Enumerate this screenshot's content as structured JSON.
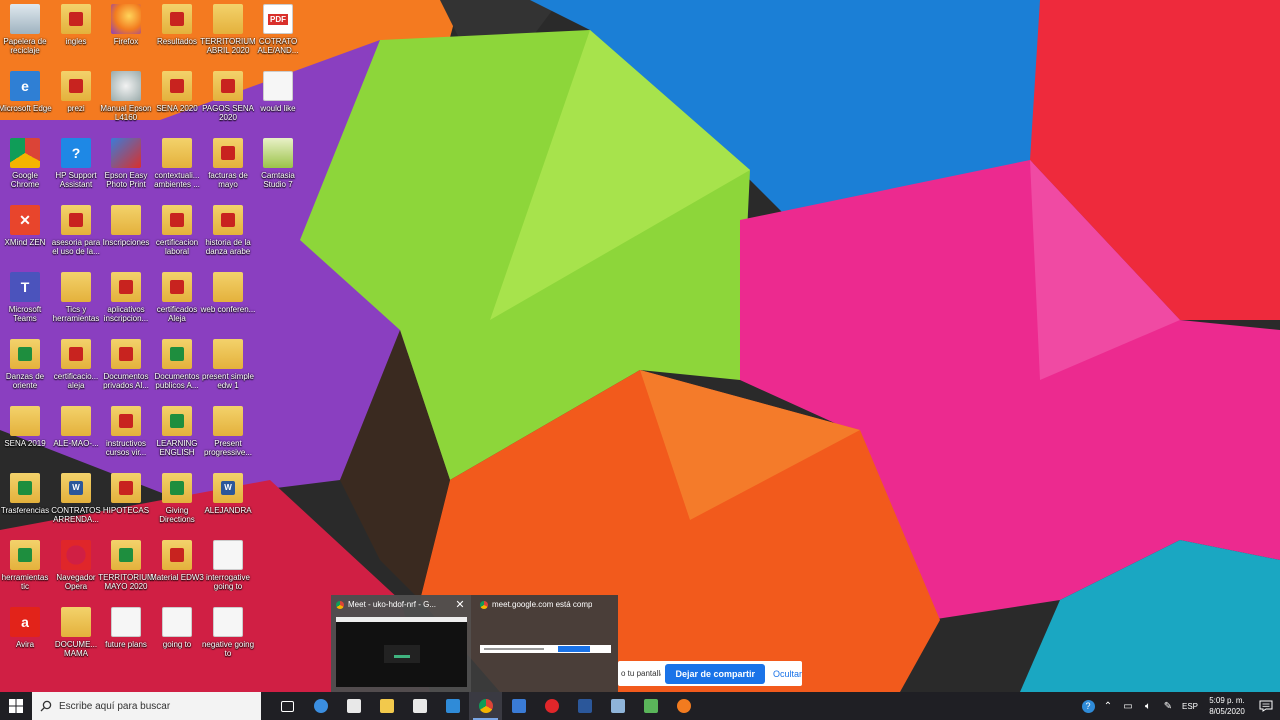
{
  "desktop_icons": [
    {
      "label": "Papelera de reciclaje",
      "type": "bin"
    },
    {
      "label": "Microsoft Edge",
      "type": "edge"
    },
    {
      "label": "Google Chrome",
      "type": "chrome"
    },
    {
      "label": "XMind ZEN",
      "type": "xmind"
    },
    {
      "label": "Microsoft Teams",
      "type": "teams"
    },
    {
      "label": "Danzas de oriente",
      "type": "folder-sheet"
    },
    {
      "label": "SENA 2019",
      "type": "folder"
    },
    {
      "label": "Trasferencias",
      "type": "folder-sheet"
    },
    {
      "label": "herramientas tic",
      "type": "folder-sheet"
    },
    {
      "label": "Avira",
      "type": "avira"
    },
    {
      "label": "ingles",
      "type": "folder-acro"
    },
    {
      "label": "prezi",
      "type": "folder-acro"
    },
    {
      "label": "HP Support Assistant",
      "type": "hp"
    },
    {
      "label": "asesoria para el uso de la...",
      "type": "folder-acro"
    },
    {
      "label": "Tics y herramientas",
      "type": "folder"
    },
    {
      "label": "certificacio... aleja",
      "type": "folder-acro"
    },
    {
      "label": "ALE-MAO-...",
      "type": "folder"
    },
    {
      "label": "CONTRATOS ARRENDA...",
      "type": "folder-word"
    },
    {
      "label": "Navegador Opera",
      "type": "opera"
    },
    {
      "label": "DOCUME... MAMA",
      "type": "folder"
    },
    {
      "label": "Firefox",
      "type": "firefox"
    },
    {
      "label": "Manual Epson L4160",
      "type": "epson"
    },
    {
      "label": "Epson Easy Photo Print",
      "type": "epsonphoto"
    },
    {
      "label": "Inscripciones",
      "type": "folder"
    },
    {
      "label": "aplicativos inscripcion...",
      "type": "folder-acro"
    },
    {
      "label": "Documentos privados Al...",
      "type": "folder-acro"
    },
    {
      "label": "instructivos cursos vir...",
      "type": "folder-acro"
    },
    {
      "label": "HIPOTECAS",
      "type": "folder-acro"
    },
    {
      "label": "TERRITORIUM MAYO 2020",
      "type": "folder-sheet"
    },
    {
      "label": "future plans",
      "type": "doc"
    },
    {
      "label": "Resultados",
      "type": "folder-acro"
    },
    {
      "label": "SENA 2020",
      "type": "folder-acro"
    },
    {
      "label": "contextuali... ambientes ...",
      "type": "folder"
    },
    {
      "label": "certificacion laboral",
      "type": "folder-acro"
    },
    {
      "label": "certificados Aleja",
      "type": "folder-acro"
    },
    {
      "label": "Documentos publicos A...",
      "type": "folder-sheet"
    },
    {
      "label": "LEARNING ENGLISH",
      "type": "folder-sheet"
    },
    {
      "label": "Giving Directions",
      "type": "folder-sheet"
    },
    {
      "label": "Material EDW3",
      "type": "folder-acro"
    },
    {
      "label": "going to",
      "type": "doc"
    },
    {
      "label": "TERRITORIUM ABRIL 2020",
      "type": "folder"
    },
    {
      "label": "PAGOS SENA 2020",
      "type": "folder-acro"
    },
    {
      "label": "facturas de mayo",
      "type": "folder-acro"
    },
    {
      "label": "historia de la danza arabe",
      "type": "folder-acro"
    },
    {
      "label": "web conferen...",
      "type": "folder"
    },
    {
      "label": "present simple edw 1",
      "type": "folder"
    },
    {
      "label": "Present progressive...",
      "type": "folder"
    },
    {
      "label": "ALEJANDRA",
      "type": "folder-word"
    },
    {
      "label": "interrogative going to",
      "type": "doc"
    },
    {
      "label": "negative going to",
      "type": "doc"
    },
    {
      "label": "COTRATO ALE/AND...",
      "type": "pdf"
    },
    {
      "label": "would like",
      "type": "doc"
    },
    {
      "label": "Camtasia Studio 7",
      "type": "camtasia"
    }
  ],
  "pdf_badge": "PDF",
  "thumbnails": [
    {
      "title": "Meet - uko-hdof-nrf - G...",
      "close": "✕"
    },
    {
      "title": "meet.google.com está compart..."
    }
  ],
  "share_bar": {
    "text": "o tu pantalla.",
    "stop_label": "Dejar de compartir",
    "hide_label": "Ocultar"
  },
  "taskbar": {
    "search_placeholder": "Escribe aquí para buscar",
    "apps": [
      {
        "name": "task-view",
        "color": "#ffffff"
      },
      {
        "name": "edge",
        "color": "#3b8ee0"
      },
      {
        "name": "dropbox",
        "color": "#e8e8e8"
      },
      {
        "name": "file-explorer",
        "color": "#f2c94c"
      },
      {
        "name": "store",
        "color": "#e8e8e8"
      },
      {
        "name": "visual-studio-code",
        "color": "#2f8bd8"
      },
      {
        "name": "chrome",
        "color": "#f4b400",
        "active": true
      },
      {
        "name": "mail",
        "color": "#3a7bd5"
      },
      {
        "name": "opera",
        "color": "#e0262a"
      },
      {
        "name": "word",
        "color": "#2b579a"
      },
      {
        "name": "notepad",
        "color": "#8fb4d9"
      },
      {
        "name": "camtasia",
        "color": "#5ab55a"
      },
      {
        "name": "firefox",
        "color": "#f27b1f"
      }
    ],
    "language": "ESP",
    "time": "5:09 p. m.",
    "date": "8/05/2020"
  }
}
